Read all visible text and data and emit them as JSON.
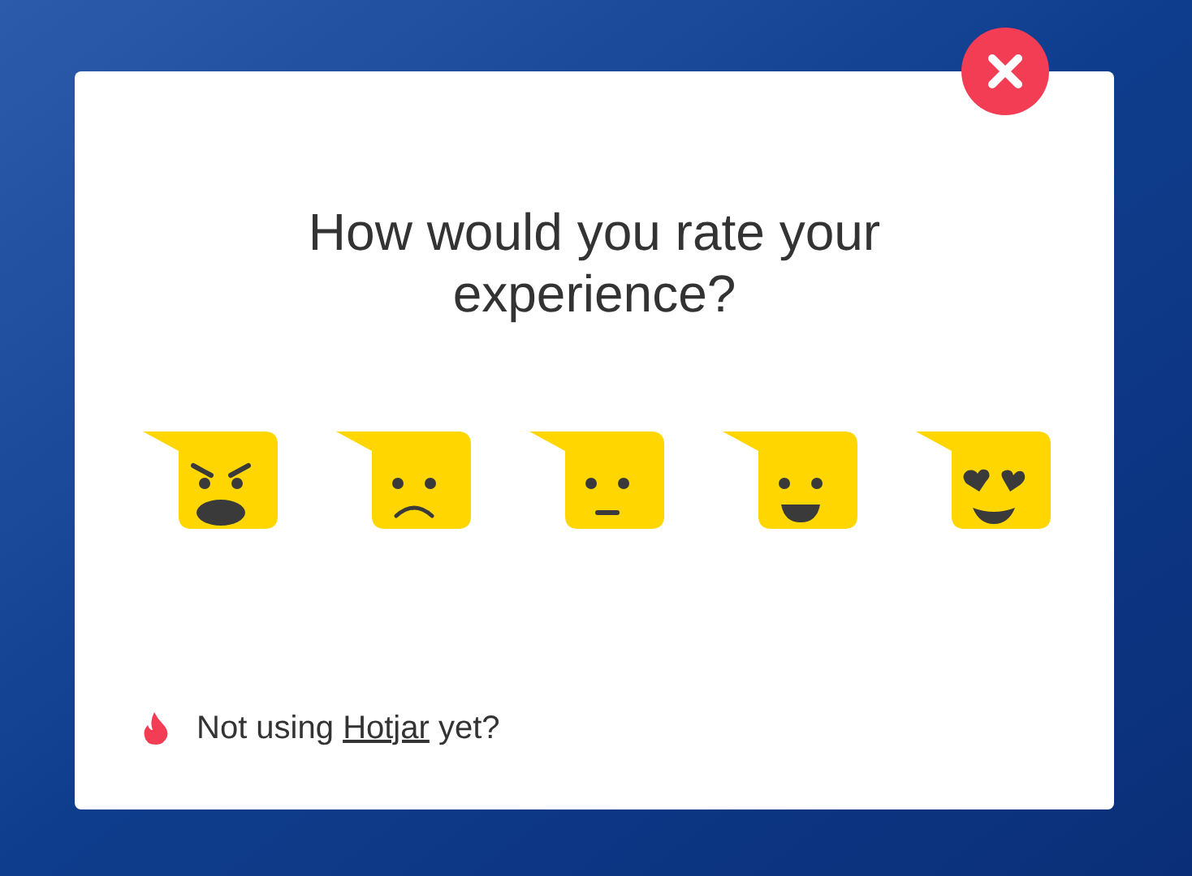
{
  "dialog": {
    "title": "How would you rate your experience?",
    "ratings": [
      {
        "kind": "angry"
      },
      {
        "kind": "sad"
      },
      {
        "kind": "neutral"
      },
      {
        "kind": "happy"
      },
      {
        "kind": "love"
      }
    ],
    "footer": {
      "before": "Not using",
      "link": "Hotjar",
      "after": "yet?"
    }
  }
}
